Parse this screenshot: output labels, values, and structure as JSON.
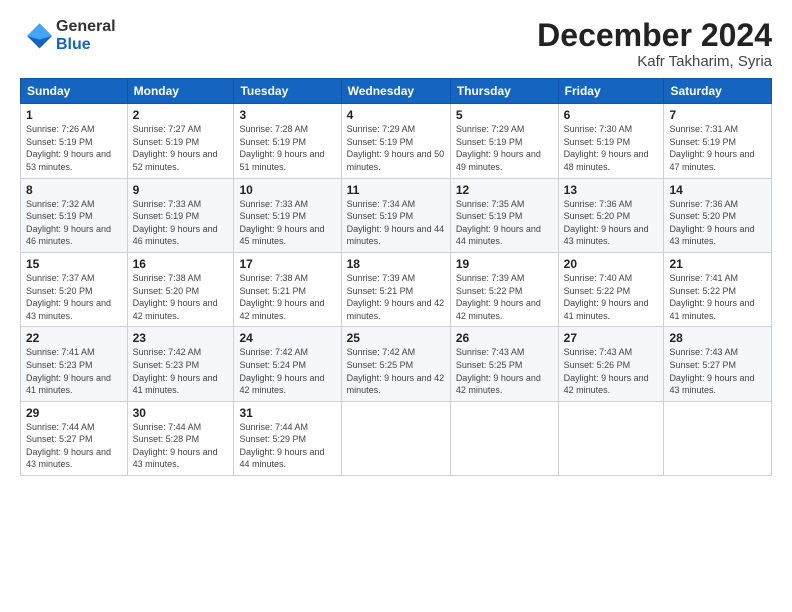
{
  "header": {
    "logo_general": "General",
    "logo_blue": "Blue",
    "title": "December 2024",
    "location": "Kafr Takharim, Syria"
  },
  "weekdays": [
    "Sunday",
    "Monday",
    "Tuesday",
    "Wednesday",
    "Thursday",
    "Friday",
    "Saturday"
  ],
  "weeks": [
    [
      {
        "day": "1",
        "sunrise": "7:26 AM",
        "sunset": "5:19 PM",
        "daylight": "9 hours and 53 minutes."
      },
      {
        "day": "2",
        "sunrise": "7:27 AM",
        "sunset": "5:19 PM",
        "daylight": "9 hours and 52 minutes."
      },
      {
        "day": "3",
        "sunrise": "7:28 AM",
        "sunset": "5:19 PM",
        "daylight": "9 hours and 51 minutes."
      },
      {
        "day": "4",
        "sunrise": "7:29 AM",
        "sunset": "5:19 PM",
        "daylight": "9 hours and 50 minutes."
      },
      {
        "day": "5",
        "sunrise": "7:29 AM",
        "sunset": "5:19 PM",
        "daylight": "9 hours and 49 minutes."
      },
      {
        "day": "6",
        "sunrise": "7:30 AM",
        "sunset": "5:19 PM",
        "daylight": "9 hours and 48 minutes."
      },
      {
        "day": "7",
        "sunrise": "7:31 AM",
        "sunset": "5:19 PM",
        "daylight": "9 hours and 47 minutes."
      }
    ],
    [
      {
        "day": "8",
        "sunrise": "7:32 AM",
        "sunset": "5:19 PM",
        "daylight": "9 hours and 46 minutes."
      },
      {
        "day": "9",
        "sunrise": "7:33 AM",
        "sunset": "5:19 PM",
        "daylight": "9 hours and 46 minutes."
      },
      {
        "day": "10",
        "sunrise": "7:33 AM",
        "sunset": "5:19 PM",
        "daylight": "9 hours and 45 minutes."
      },
      {
        "day": "11",
        "sunrise": "7:34 AM",
        "sunset": "5:19 PM",
        "daylight": "9 hours and 44 minutes."
      },
      {
        "day": "12",
        "sunrise": "7:35 AM",
        "sunset": "5:19 PM",
        "daylight": "9 hours and 44 minutes."
      },
      {
        "day": "13",
        "sunrise": "7:36 AM",
        "sunset": "5:20 PM",
        "daylight": "9 hours and 43 minutes."
      },
      {
        "day": "14",
        "sunrise": "7:36 AM",
        "sunset": "5:20 PM",
        "daylight": "9 hours and 43 minutes."
      }
    ],
    [
      {
        "day": "15",
        "sunrise": "7:37 AM",
        "sunset": "5:20 PM",
        "daylight": "9 hours and 43 minutes."
      },
      {
        "day": "16",
        "sunrise": "7:38 AM",
        "sunset": "5:20 PM",
        "daylight": "9 hours and 42 minutes."
      },
      {
        "day": "17",
        "sunrise": "7:38 AM",
        "sunset": "5:21 PM",
        "daylight": "9 hours and 42 minutes."
      },
      {
        "day": "18",
        "sunrise": "7:39 AM",
        "sunset": "5:21 PM",
        "daylight": "9 hours and 42 minutes."
      },
      {
        "day": "19",
        "sunrise": "7:39 AM",
        "sunset": "5:22 PM",
        "daylight": "9 hours and 42 minutes."
      },
      {
        "day": "20",
        "sunrise": "7:40 AM",
        "sunset": "5:22 PM",
        "daylight": "9 hours and 41 minutes."
      },
      {
        "day": "21",
        "sunrise": "7:41 AM",
        "sunset": "5:22 PM",
        "daylight": "9 hours and 41 minutes."
      }
    ],
    [
      {
        "day": "22",
        "sunrise": "7:41 AM",
        "sunset": "5:23 PM",
        "daylight": "9 hours and 41 minutes."
      },
      {
        "day": "23",
        "sunrise": "7:42 AM",
        "sunset": "5:23 PM",
        "daylight": "9 hours and 41 minutes."
      },
      {
        "day": "24",
        "sunrise": "7:42 AM",
        "sunset": "5:24 PM",
        "daylight": "9 hours and 42 minutes."
      },
      {
        "day": "25",
        "sunrise": "7:42 AM",
        "sunset": "5:25 PM",
        "daylight": "9 hours and 42 minutes."
      },
      {
        "day": "26",
        "sunrise": "7:43 AM",
        "sunset": "5:25 PM",
        "daylight": "9 hours and 42 minutes."
      },
      {
        "day": "27",
        "sunrise": "7:43 AM",
        "sunset": "5:26 PM",
        "daylight": "9 hours and 42 minutes."
      },
      {
        "day": "28",
        "sunrise": "7:43 AM",
        "sunset": "5:27 PM",
        "daylight": "9 hours and 43 minutes."
      }
    ],
    [
      {
        "day": "29",
        "sunrise": "7:44 AM",
        "sunset": "5:27 PM",
        "daylight": "9 hours and 43 minutes."
      },
      {
        "day": "30",
        "sunrise": "7:44 AM",
        "sunset": "5:28 PM",
        "daylight": "9 hours and 43 minutes."
      },
      {
        "day": "31",
        "sunrise": "7:44 AM",
        "sunset": "5:29 PM",
        "daylight": "9 hours and 44 minutes."
      },
      null,
      null,
      null,
      null
    ]
  ]
}
